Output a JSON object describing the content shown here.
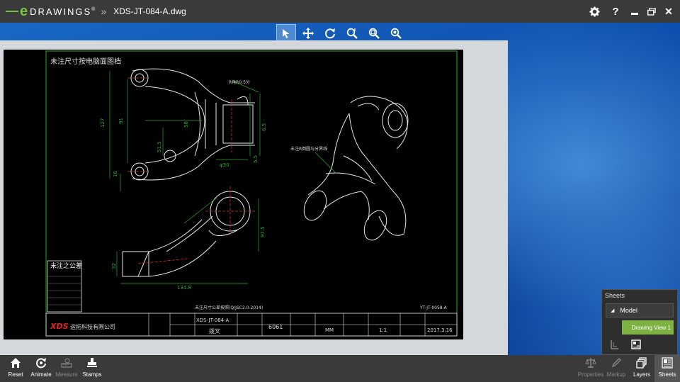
{
  "app": {
    "logo_mark": "e",
    "logo_text": "DRAWINGS",
    "logo_reg": "®",
    "breadcrumb_chevron": "»",
    "document_title": "XDS-JT-084-A.dwg"
  },
  "title_bar": {
    "settings_icon": "gear-icon",
    "help_label": "?",
    "minimize_label": "▬",
    "restore_label": "❐",
    "close_label": "✕"
  },
  "view_toolbar": {
    "tools": [
      {
        "name": "select-tool",
        "icon": "pointer-icon",
        "glyph": "➤",
        "active": true
      },
      {
        "name": "pan-tool",
        "icon": "move-icon",
        "glyph": "✥"
      },
      {
        "name": "rotate-tool",
        "icon": "rotate-icon",
        "glyph": "⟳"
      },
      {
        "name": "zoom-tool",
        "icon": "zoom-icon",
        "glyph": "🔍"
      },
      {
        "name": "zoom-to-fit-tool",
        "icon": "zoom-fit-icon",
        "glyph": "🔍"
      },
      {
        "name": "zoom-to-area-tool",
        "icon": "zoom-area-icon",
        "glyph": "🔍"
      }
    ]
  },
  "drawing": {
    "heading": "未注尺寸按电脑面图档",
    "label_3d": "未注R倒圆与分界线",
    "label_top": "R角R0.5分",
    "tolerance_title": "未注之公差",
    "dims": [
      "127",
      "91",
      "58",
      "51.5",
      "5.5",
      "16",
      "32",
      "134.8",
      "97.5",
      "φ30",
      "6.5"
    ],
    "note_center": "未注尺寸公差按照(Q/JSC2.0-2014)",
    "drawing_no": "YT-JT-0058-A",
    "company": "XDS",
    "company_name": "运拓科技有限公司",
    "title_block": {
      "part_no": "XDS-JT-084-A",
      "part_name": "拨叉",
      "material": "6061",
      "unit": "MM",
      "scale": "1:1",
      "date": "2017.3.16"
    }
  },
  "sheets_panel": {
    "title": "Sheets",
    "model_label": "Model",
    "view_label": "Drawing View 1"
  },
  "bottom_toolbar": {
    "left": [
      {
        "name": "reset",
        "label": "Reset",
        "glyph": "⌂",
        "disabled": false
      },
      {
        "name": "animate",
        "label": "Animate",
        "glyph": "⟲",
        "disabled": false
      },
      {
        "name": "measure",
        "label": "Measure",
        "glyph": "📏",
        "disabled": true
      },
      {
        "name": "stamps",
        "label": "Stamps",
        "glyph": "⊥",
        "disabled": false
      }
    ],
    "right": [
      {
        "name": "properties",
        "label": "Properties",
        "glyph": "⚖",
        "disabled": true
      },
      {
        "name": "markup",
        "label": "Markup",
        "glyph": "✎",
        "disabled": true
      },
      {
        "name": "layers",
        "label": "Layers",
        "glyph": "≣",
        "disabled": false
      },
      {
        "name": "sheets",
        "label": "Sheets",
        "glyph": "▦",
        "disabled": false,
        "active": true
      }
    ]
  }
}
